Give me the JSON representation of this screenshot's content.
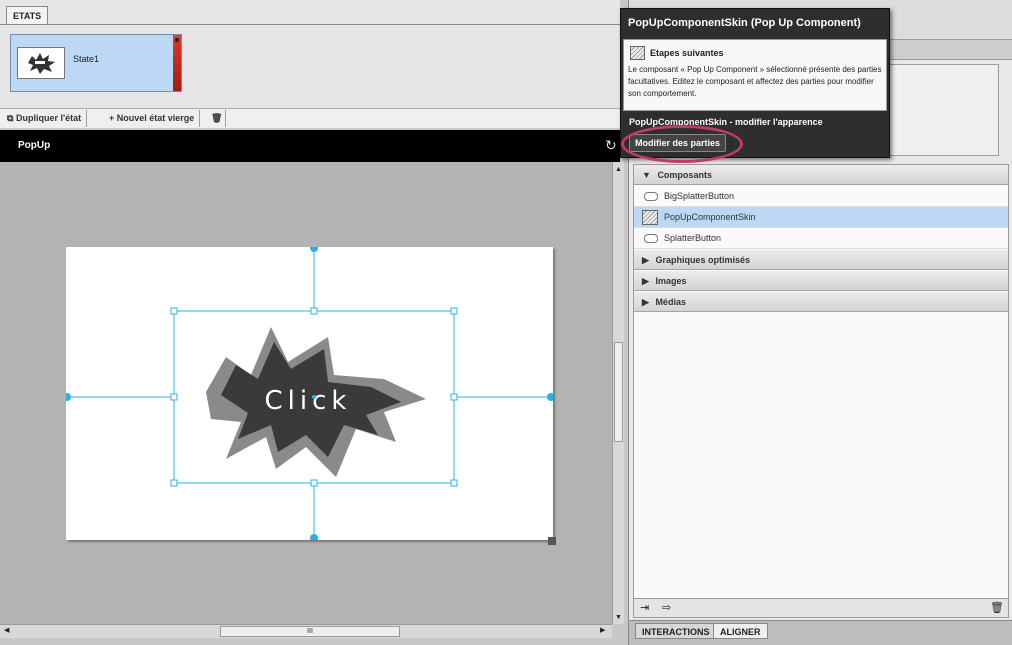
{
  "states_panel": {
    "tab_label": "ETATS",
    "state_name": "State1",
    "toolbar": {
      "duplicate_label": "Dupliquer l'état",
      "new_blank_label": "Nouvel état vierge"
    }
  },
  "document": {
    "title": "PopUp",
    "splatter_text": "Click"
  },
  "scrollbar": {
    "grip": "III"
  },
  "library": {
    "sections": {
      "components": "Composants",
      "optimized_graphics": "Graphiques optimisés",
      "images": "Images",
      "media": "Médias"
    },
    "items": [
      {
        "label": "BigSplatterButton",
        "icon": "button-component-icon"
      },
      {
        "label": "PopUpComponentSkin",
        "icon": "skin-component-icon"
      },
      {
        "label": "SplatterButton",
        "icon": "button-component-icon"
      }
    ]
  },
  "right_tabs": {
    "interactions": "INTERACTIONS",
    "align": "ALIGNER"
  },
  "tooltip": {
    "title": "PopUpComponentSkin (Pop Up Component)",
    "heading": "Etapes suivantes",
    "body": "Le composant « Pop Up Component » sélectionné présente des parties facultatives. Editez le composant et affectez des parties pour modifier son comportement.",
    "subtitle": "PopUpComponentSkin - modifier l'apparence",
    "button": "Modifier des parties"
  },
  "colors": {
    "selection_blue": "#bcd8f5",
    "handle_cyan": "#2ab0e8",
    "highlight_magenta": "#c0396f",
    "state_red": "#d42a1e"
  }
}
